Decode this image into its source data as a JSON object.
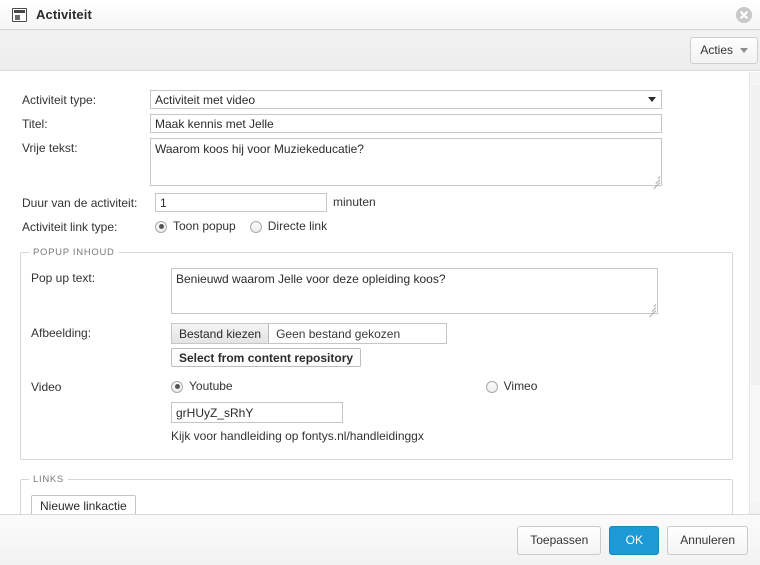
{
  "window": {
    "title": "Activiteit",
    "icon": "window-panel-icon",
    "close_icon": "close-circle-icon"
  },
  "toolbar": {
    "actions_label": "Acties",
    "actions_caret": "chevron-down-icon"
  },
  "form": {
    "activity_type": {
      "label": "Activiteit type:",
      "value": "Activiteit met video"
    },
    "title": {
      "label": "Titel:",
      "value": "Maak kennis met Jelle"
    },
    "free_text": {
      "label": "Vrije tekst:",
      "value": "Waarom koos hij voor Muziekeducatie?"
    },
    "duration": {
      "label": "Duur van de activiteit:",
      "value": "1",
      "suffix": "minuten"
    },
    "link_type": {
      "label": "Activiteit link type:",
      "options": [
        {
          "label": "Toon popup",
          "selected": true
        },
        {
          "label": "Directe link",
          "selected": false
        }
      ]
    }
  },
  "popup_content": {
    "legend": "POPUP INHOUD",
    "popup_text": {
      "label": "Pop up text:",
      "value": "Benieuwd waarom Jelle voor deze opleiding koos?"
    },
    "image": {
      "label": "Afbeelding:",
      "choose_button": "Bestand kiezen",
      "file_status": "Geen bestand gekozen",
      "repository_button": "Select from content repository"
    },
    "video": {
      "label": "Video",
      "options": [
        {
          "label": "Youtube",
          "selected": true
        },
        {
          "label": "Vimeo",
          "selected": false
        }
      ],
      "id_value": "grHUyZ_sRhY",
      "hint": "Kijk voor handleiding op fontys.nl/handleidinggx"
    }
  },
  "links": {
    "legend": "LINKS",
    "new_link_button": "Nieuwe linkactie"
  },
  "footer": {
    "apply": "Toepassen",
    "ok": "OK",
    "cancel": "Annuleren"
  },
  "colors": {
    "primary": "#1c9ad6",
    "border": "#c6c6c6",
    "text": "#333333"
  }
}
